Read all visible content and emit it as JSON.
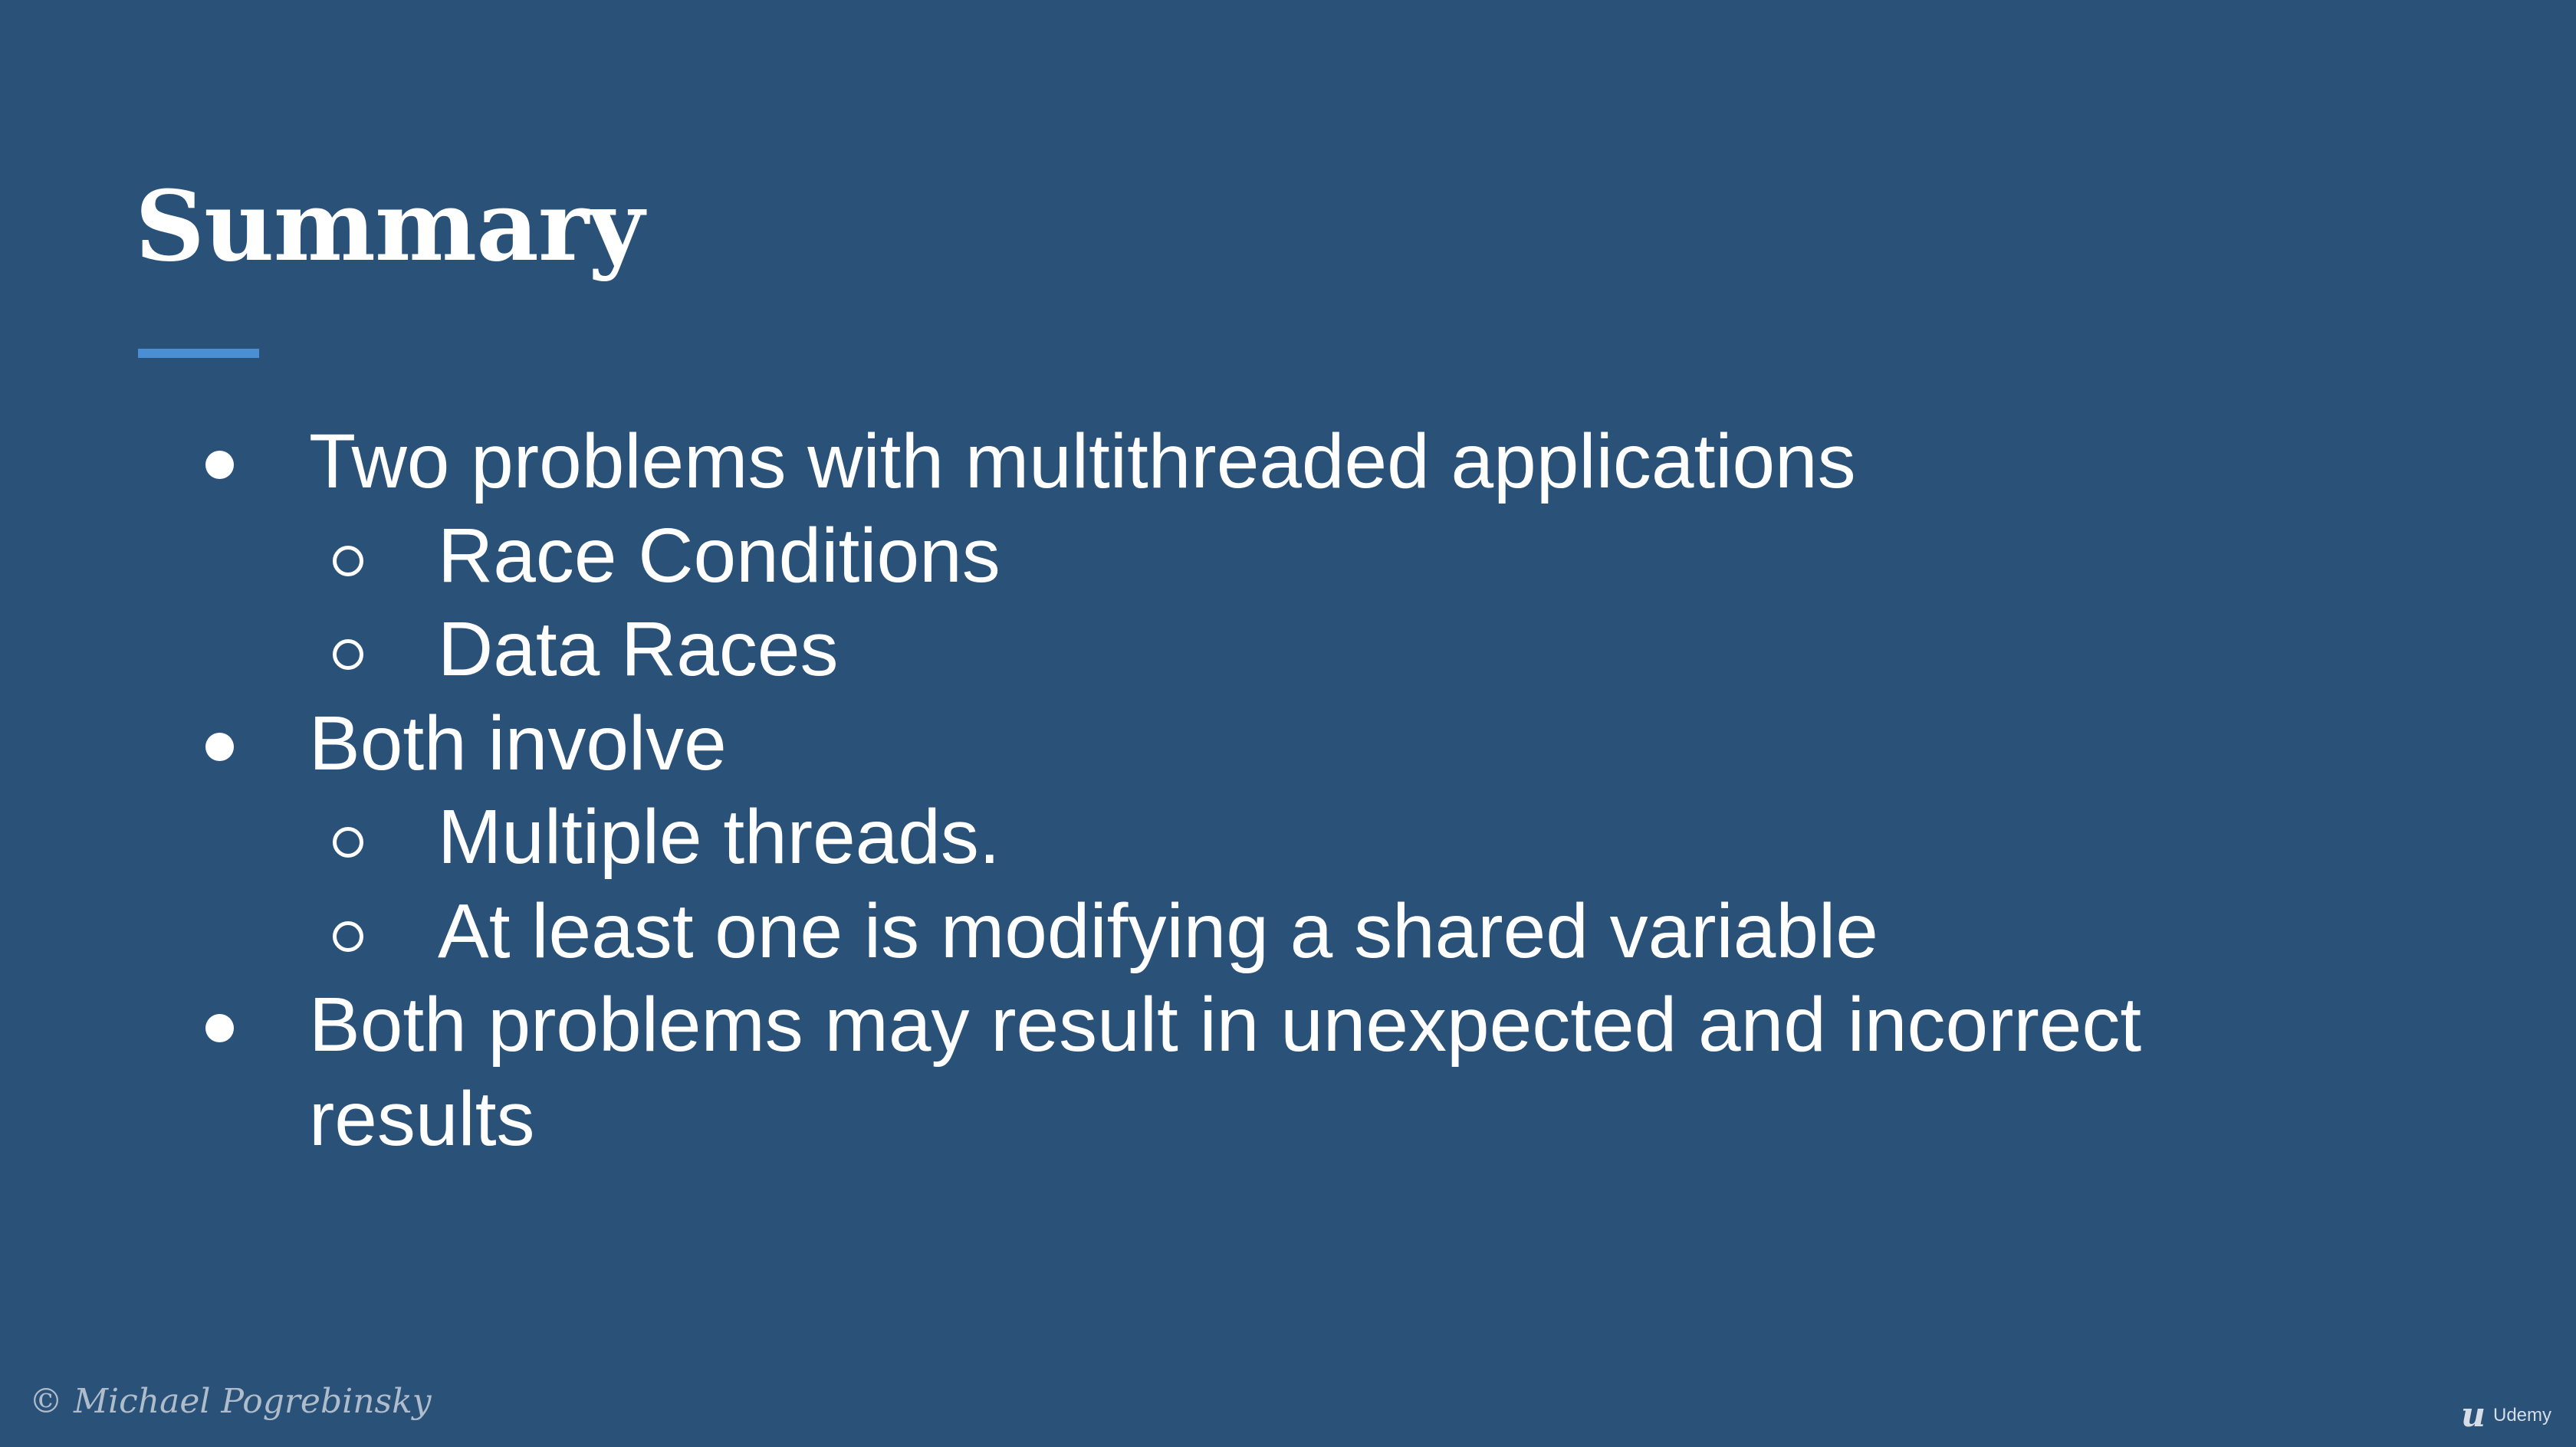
{
  "slide": {
    "title": "Summary",
    "bullets": [
      {
        "text": "Two problems with multithreaded applications",
        "subitems": [
          "Race Conditions",
          "Data Races"
        ]
      },
      {
        "text": "Both involve",
        "subitems": [
          "Multiple threads.",
          "At least one is modifying a shared variable"
        ]
      },
      {
        "text_lines": [
          "Both problems may result in unexpected and incorrect",
          "results"
        ],
        "subitems": []
      }
    ]
  },
  "footer": {
    "copyright": "© Michael Pogrebinsky",
    "brand_text": "Udemy",
    "brand_icon": "udemy-logo-icon"
  },
  "colors": {
    "background": "#2a5178",
    "text": "#ffffff",
    "accent_underline": "#4a8fd3"
  }
}
